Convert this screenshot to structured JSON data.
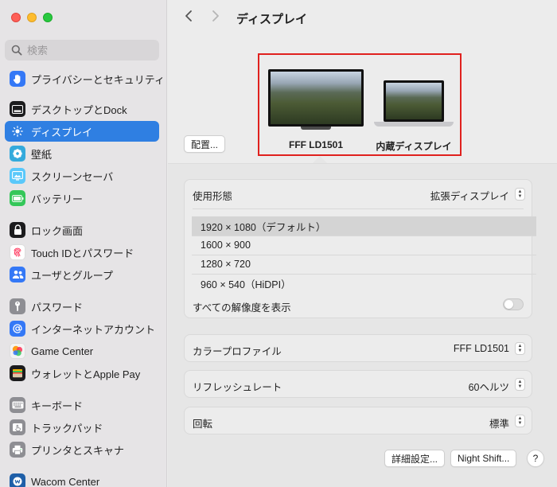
{
  "window": {
    "title": "ディスプレイ"
  },
  "search": {
    "placeholder": "検索",
    "value": ""
  },
  "sidebar": {
    "items": [
      {
        "label": "プライバシーとセキュリティ",
        "icon": "hand-icon",
        "color": "#3478f6",
        "active": false
      },
      {
        "label": "デスクトップとDock",
        "icon": "dock-icon",
        "color": "#1c1c1e",
        "active": false
      },
      {
        "label": "ディスプレイ",
        "icon": "sun-icon",
        "color": "#2f7fe2",
        "active": true
      },
      {
        "label": "壁紙",
        "icon": "flower-icon",
        "color": "#34aadc",
        "active": false
      },
      {
        "label": "スクリーンセーバ",
        "icon": "screensaver-icon",
        "color": "#5ac8fa",
        "active": false
      },
      {
        "label": "バッテリー",
        "icon": "battery-icon",
        "color": "#34c759",
        "active": false
      },
      {
        "label": "ロック画面",
        "icon": "lock-icon",
        "color": "#1c1c1e",
        "active": false
      },
      {
        "label": "Touch IDとパスワード",
        "icon": "fingerprint-icon",
        "color": "#ff2d55",
        "active": false
      },
      {
        "label": "ユーザとグループ",
        "icon": "users-icon",
        "color": "#3478f6",
        "active": false
      },
      {
        "label": "パスワード",
        "icon": "key-icon",
        "color": "#8e8e93",
        "active": false
      },
      {
        "label": "インターネットアカウント",
        "icon": "at-icon",
        "color": "#3478f6",
        "active": false
      },
      {
        "label": "Game Center",
        "icon": "game-center-icon",
        "color": "#ff9500",
        "active": false
      },
      {
        "label": "ウォレットとApple Pay",
        "icon": "wallet-icon",
        "color": "#1c1c1e",
        "active": false
      },
      {
        "label": "キーボード",
        "icon": "keyboard-icon",
        "color": "#8e8e93",
        "active": false
      },
      {
        "label": "トラックパッド",
        "icon": "trackpad-icon",
        "color": "#8e8e93",
        "active": false
      },
      {
        "label": "プリンタとスキャナ",
        "icon": "printer-icon",
        "color": "#8e8e93",
        "active": false
      },
      {
        "label": "Wacom Center",
        "icon": "wacom-icon",
        "color": "#1f5fa8",
        "active": false
      }
    ]
  },
  "toolbar": {
    "title": "ディスプレイ",
    "back_icon": "chevron-left-icon",
    "forward_icon": "chevron-right-icon"
  },
  "arrangement": {
    "arrange_label": "配置...",
    "displays": [
      {
        "name": "FFF LD1501",
        "kind": "external-monitor"
      },
      {
        "name": "内蔵ディスプレイ",
        "kind": "built-in-laptop"
      }
    ],
    "highlight_color": "#e0211e"
  },
  "settings": {
    "usage_label": "使用形態",
    "usage_value": "拡張ディスプレイ",
    "resolutions": [
      {
        "label": "1920 × 1080（デフォルト）",
        "selected": true
      },
      {
        "label": "1600 × 900",
        "selected": false
      },
      {
        "label": "1280 × 720",
        "selected": false
      },
      {
        "label": "960 × 540（HiDPI）",
        "selected": false
      }
    ],
    "show_all_label": "すべての解像度を表示",
    "show_all_on": false,
    "color_profile_label": "カラープロファイル",
    "color_profile_value": "FFF LD1501",
    "refresh_label": "リフレッシュレート",
    "refresh_value": "60ヘルツ",
    "rotation_label": "回転",
    "rotation_value": "標準"
  },
  "footer": {
    "advanced_label": "詳細設定...",
    "night_shift_label": "Night Shift...",
    "help_label": "?"
  }
}
